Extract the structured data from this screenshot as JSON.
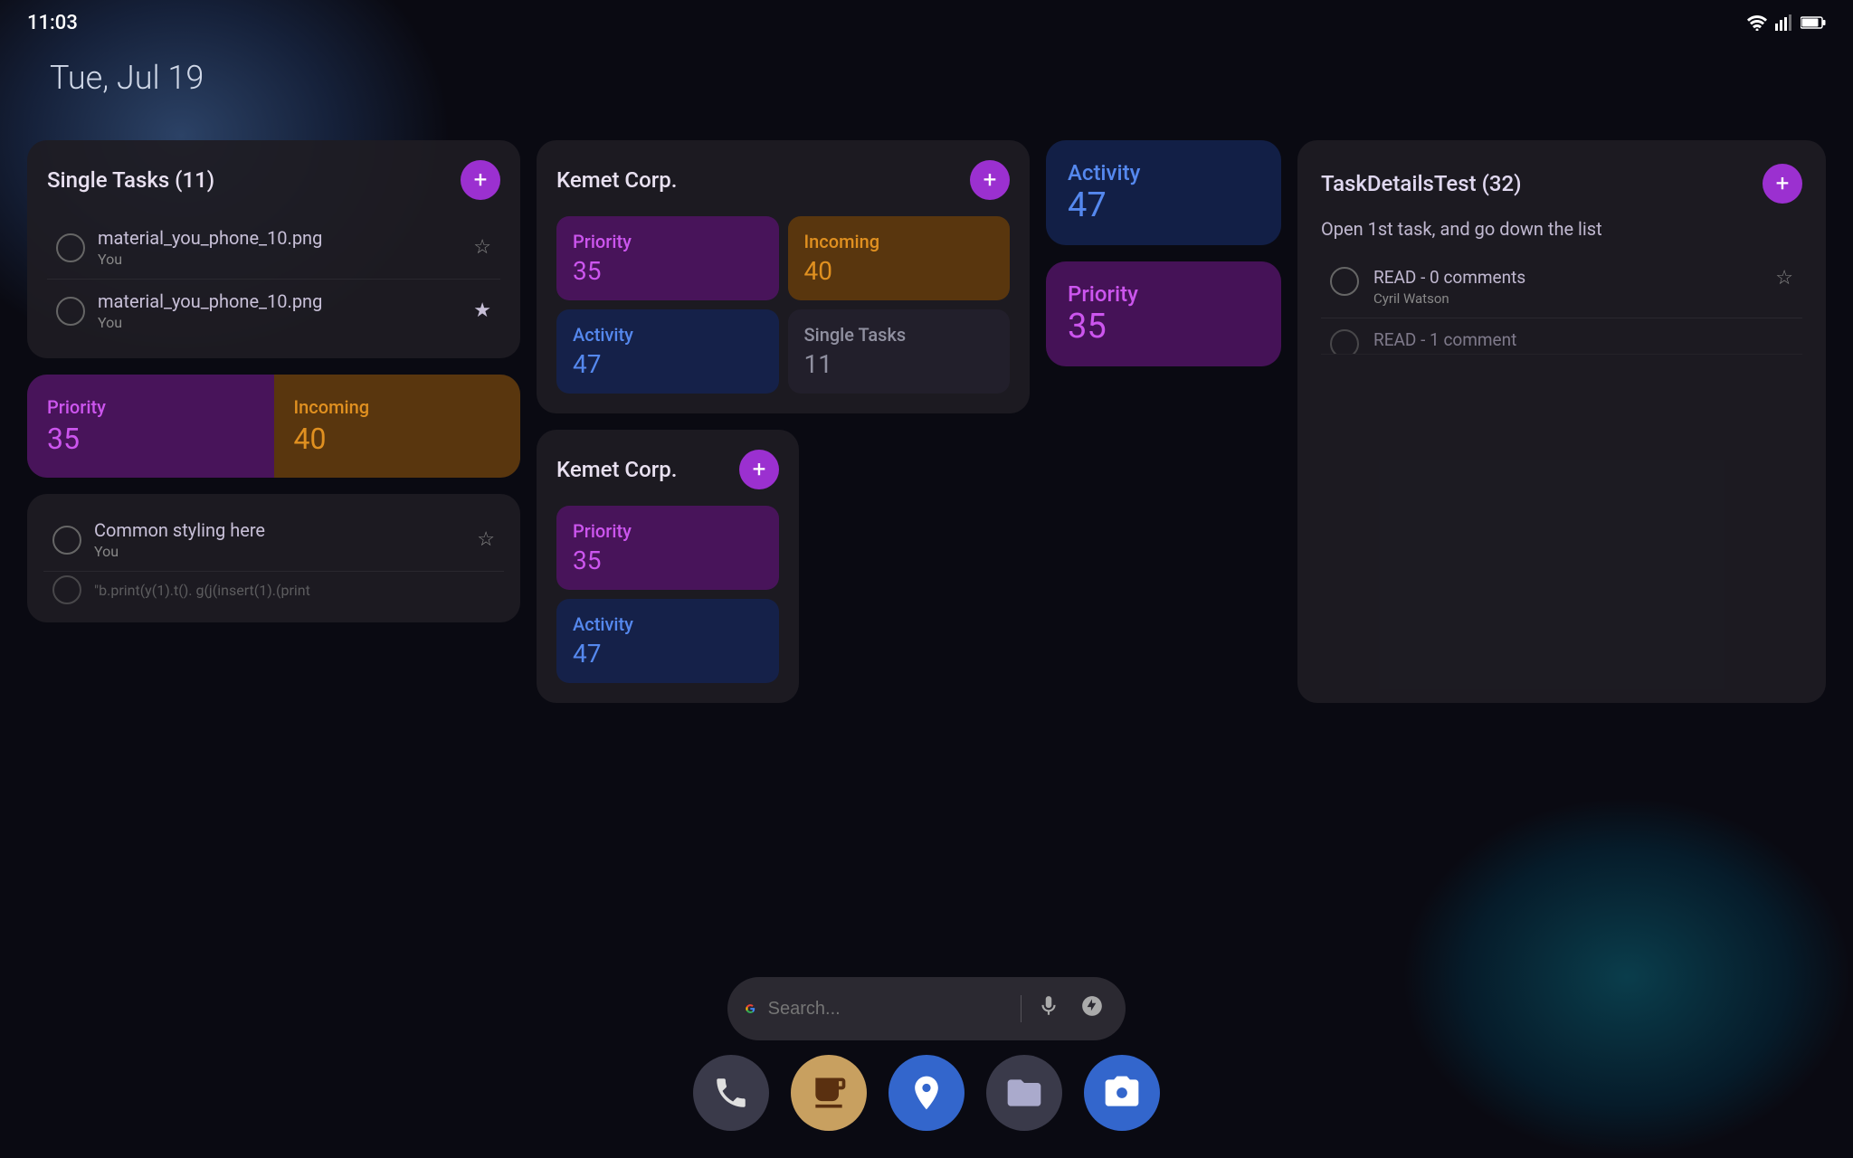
{
  "status": {
    "time": "11:03"
  },
  "date": "Tue, Jul 19",
  "widgets": {
    "single_tasks": {
      "title": "Single Tasks (11)",
      "add_label": "+",
      "tasks": [
        {
          "name": "material_you_phone_10.png",
          "sub": "You",
          "starred": false
        },
        {
          "name": "material_you_phone_10.png",
          "sub": "You",
          "starred": true
        },
        {
          "name": "Common styling here",
          "sub": "You",
          "starred": false
        },
        {
          "name": "\"b.print(y(1).t(). g(j(insert(1).(print",
          "sub": "",
          "starred": false
        }
      ]
    },
    "kemet_large": {
      "title": "Kemet Corp.",
      "cells": [
        {
          "label": "Priority",
          "value": "35",
          "color": "purple"
        },
        {
          "label": "Incoming",
          "value": "40",
          "color": "orange"
        },
        {
          "label": "Activity",
          "value": "47",
          "color": "blue"
        },
        {
          "label": "Single Tasks",
          "value": "11",
          "color": "gray"
        }
      ]
    },
    "activity_top_right": {
      "label": "Activity",
      "value": "47"
    },
    "priority_top_right": {
      "label": "Priority",
      "value": "35"
    },
    "priority_incoming_left": {
      "priority_label": "Priority",
      "priority_value": "35",
      "incoming_label": "Incoming",
      "incoming_value": "40"
    },
    "kemet_small": {
      "title": "Kemet Corp.",
      "cells": [
        {
          "label": "Priority",
          "value": "35",
          "color": "purple"
        },
        {
          "label": "Activity",
          "value": "47",
          "color": "blue"
        }
      ]
    },
    "task_details": {
      "title": "TaskDetailsTest (32)",
      "description": "Open 1st task, and go down the list",
      "tasks": [
        {
          "name": "READ - 0 comments",
          "sub": "Cyril Watson",
          "starred": false
        },
        {
          "name": "READ - 1 comment",
          "sub": "",
          "starred": false
        }
      ]
    }
  },
  "search": {
    "placeholder": "Search..."
  },
  "dock": {
    "apps": [
      {
        "name": "Phone",
        "icon": "📞"
      },
      {
        "name": "App1",
        "icon": ""
      },
      {
        "name": "Maps",
        "icon": ""
      },
      {
        "name": "Files",
        "icon": ""
      },
      {
        "name": "Camera",
        "icon": ""
      }
    ]
  }
}
